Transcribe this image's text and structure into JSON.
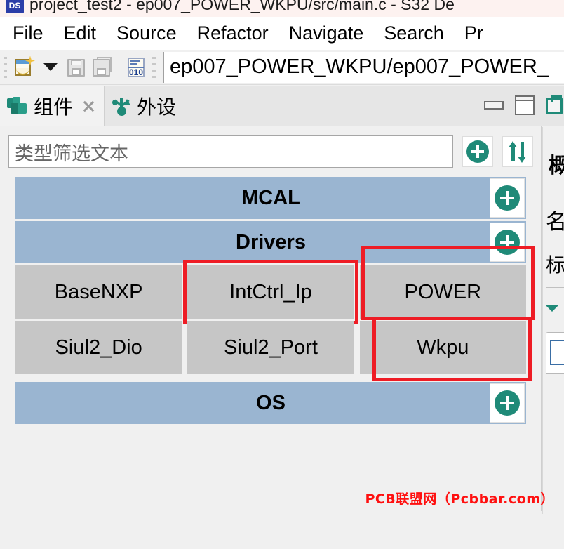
{
  "window": {
    "title": "project_test2 - ep007_POWER_WKPU/src/main.c - S32 De",
    "app_icon": "DS"
  },
  "menubar": {
    "items": [
      {
        "label": "File"
      },
      {
        "label": "Edit"
      },
      {
        "label": "Source"
      },
      {
        "label": "Refactor"
      },
      {
        "label": "Navigate"
      },
      {
        "label": "Search"
      },
      {
        "label": "Pr"
      }
    ]
  },
  "toolbar": {
    "icons": [
      {
        "name": "new-file-icon"
      },
      {
        "name": "dropdown-caret-icon"
      },
      {
        "name": "save-icon"
      },
      {
        "name": "save-all-icon"
      },
      {
        "name": "hex-editor-icon",
        "label": "010"
      }
    ],
    "path_field": {
      "value": "ep007_POWER_WKPU/ep007_POWER_",
      "placeholder": ""
    }
  },
  "view_panel": {
    "tabs": [
      {
        "label": "组件",
        "icon": "components-icon",
        "active": true,
        "closable": true
      },
      {
        "label": "外设",
        "icon": "usb-peripheral-icon",
        "active": false,
        "closable": false
      }
    ],
    "controls": [
      {
        "name": "minimize-panel-button"
      },
      {
        "name": "maximize-panel-button"
      }
    ],
    "filter": {
      "placeholder": "类型筛选文本",
      "value": ""
    },
    "filter_buttons": [
      {
        "name": "add-component-button",
        "icon": "plus-circle-icon"
      },
      {
        "name": "sort-toggle-button",
        "icon": "sort-arrows-icon"
      }
    ],
    "sections": [
      {
        "title": "MCAL",
        "add_button_label": "+",
        "tiles": []
      },
      {
        "title": "Drivers",
        "add_button_label": "+",
        "tiles": [
          [
            {
              "label": "BaseNXP",
              "highlighted": false
            },
            {
              "label": "IntCtrl_Ip",
              "highlighted": true
            },
            {
              "label": "POWER",
              "highlighted": true
            }
          ],
          [
            {
              "label": "Siul2_Dio",
              "highlighted": false
            },
            {
              "label": "Siul2_Port",
              "highlighted": false
            },
            {
              "label": "Wkpu",
              "highlighted": true
            }
          ]
        ]
      },
      {
        "title": "OS",
        "add_button_label": "+",
        "tiles": []
      }
    ]
  },
  "right_panel": {
    "tab_icon": "properties-icon",
    "clipped_text": {
      "line1": "概",
      "line2": "名",
      "line3": "标"
    }
  },
  "watermark": {
    "text": "PCB联盟网（Pcbbar.com）"
  },
  "colors": {
    "section_header_blue": "#9ab5d1",
    "tile_gray": "#c6c6c6",
    "accent_teal": "#1f8a78",
    "highlight_red": "#ee1c25",
    "titlebar_pink": "#fdf2f0",
    "watermark_red": "#ff1010"
  }
}
